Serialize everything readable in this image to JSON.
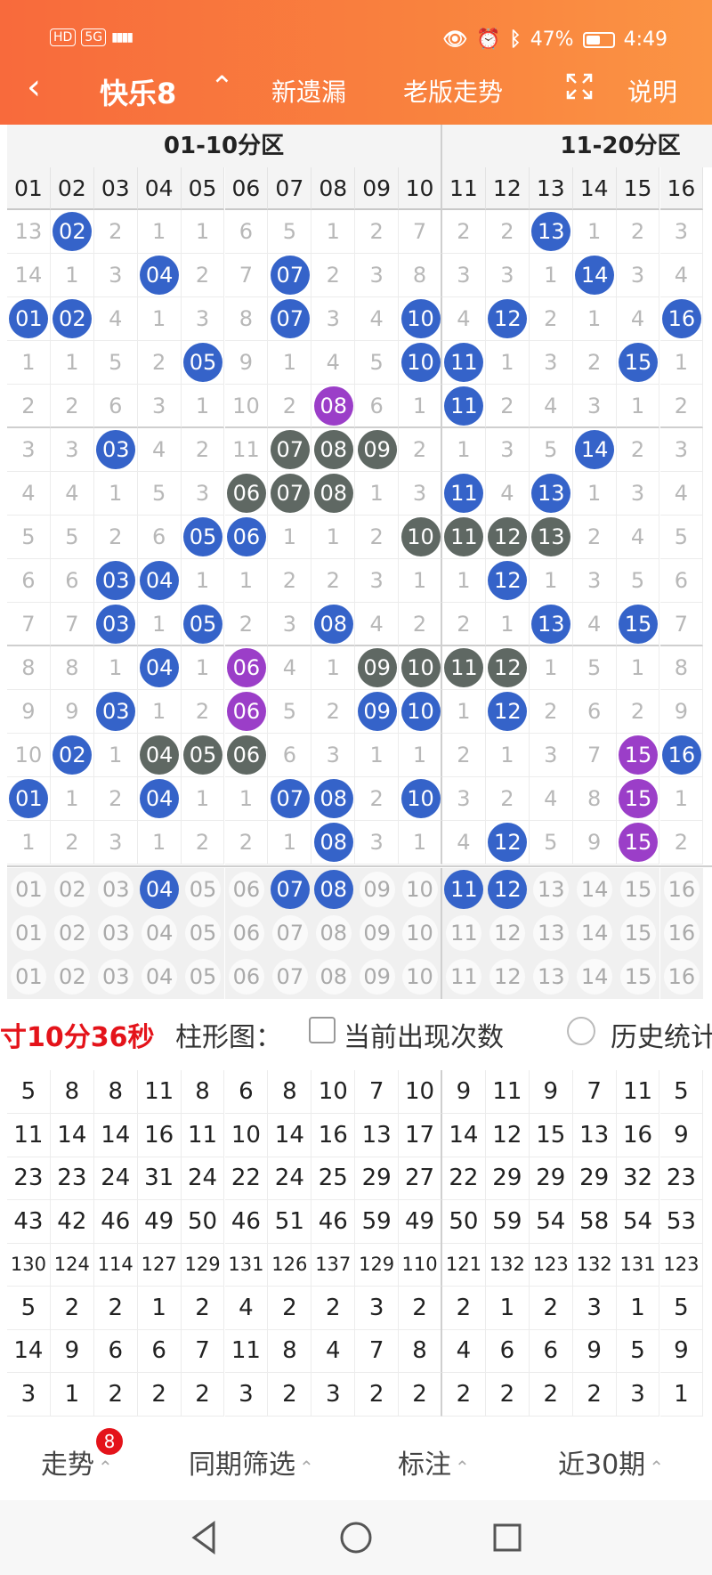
{
  "status_bar": {
    "badges": [
      "HD",
      "5G"
    ],
    "signal": "▮▮▮▮",
    "battery": "47%",
    "time": "4:49"
  },
  "nav": {
    "title": "快乐8",
    "items": [
      "新遗漏",
      "老版走势",
      "说明"
    ]
  },
  "zones": [
    "01-10分区",
    "11-20分区"
  ],
  "columns": [
    "01",
    "02",
    "03",
    "04",
    "05",
    "06",
    "07",
    "08",
    "09",
    "10",
    "11",
    "12",
    "13",
    "14",
    "15",
    "16"
  ],
  "grid_rows": [
    [
      "13",
      "02",
      "2",
      "1",
      "1",
      "6",
      "5",
      "1",
      "2",
      "7",
      "2",
      "2",
      "13",
      "1",
      "2",
      "3"
    ],
    [
      "14",
      "1",
      "3",
      "04",
      "2",
      "7",
      "07",
      "2",
      "3",
      "8",
      "3",
      "3",
      "1",
      "14",
      "3",
      "4"
    ],
    [
      "01",
      "02",
      "4",
      "1",
      "3",
      "8",
      "07",
      "3",
      "4",
      "10",
      "4",
      "12",
      "2",
      "1",
      "4",
      "16"
    ],
    [
      "1",
      "1",
      "5",
      "2",
      "05",
      "9",
      "1",
      "4",
      "5",
      "10",
      "11",
      "1",
      "3",
      "2",
      "15",
      "1"
    ],
    [
      "2",
      "2",
      "6",
      "3",
      "1",
      "10",
      "2",
      "08",
      "6",
      "1",
      "11",
      "2",
      "4",
      "3",
      "1",
      "2"
    ],
    [
      "3",
      "3",
      "03",
      "4",
      "2",
      "11",
      "07",
      "08",
      "09",
      "2",
      "1",
      "3",
      "5",
      "14",
      "2",
      "3"
    ],
    [
      "4",
      "4",
      "1",
      "5",
      "3",
      "06",
      "07",
      "08",
      "1",
      "3",
      "11",
      "4",
      "13",
      "1",
      "3",
      "4"
    ],
    [
      "5",
      "5",
      "2",
      "6",
      "05",
      "06",
      "1",
      "1",
      "2",
      "10",
      "11",
      "12",
      "13",
      "2",
      "4",
      "5"
    ],
    [
      "6",
      "6",
      "03",
      "04",
      "1",
      "1",
      "2",
      "2",
      "3",
      "1",
      "1",
      "12",
      "1",
      "3",
      "5",
      "6"
    ],
    [
      "7",
      "7",
      "03",
      "1",
      "05",
      "2",
      "3",
      "08",
      "4",
      "2",
      "2",
      "1",
      "13",
      "4",
      "15",
      "7"
    ],
    [
      "8",
      "8",
      "1",
      "04",
      "1",
      "06",
      "4",
      "1",
      "09",
      "10",
      "11",
      "12",
      "1",
      "5",
      "1",
      "8"
    ],
    [
      "9",
      "9",
      "03",
      "1",
      "2",
      "06",
      "5",
      "2",
      "09",
      "10",
      "1",
      "12",
      "2",
      "6",
      "2",
      "9"
    ],
    [
      "10",
      "02",
      "1",
      "04",
      "05",
      "06",
      "6",
      "3",
      "1",
      "1",
      "2",
      "1",
      "3",
      "7",
      "15",
      "16"
    ],
    [
      "01",
      "1",
      "2",
      "04",
      "1",
      "1",
      "07",
      "08",
      "2",
      "10",
      "3",
      "2",
      "4",
      "8",
      "15",
      "1"
    ],
    [
      "1",
      "2",
      "3",
      "1",
      "2",
      "2",
      "1",
      "08",
      "3",
      "1",
      "4",
      "12",
      "5",
      "9",
      "15",
      "2"
    ]
  ],
  "ball_styles": [
    [
      "",
      "b",
      "",
      "",
      "",
      "",
      "",
      "",
      "",
      "",
      "",
      "",
      "b",
      "",
      "",
      ""
    ],
    [
      "",
      "",
      "",
      "b",
      "",
      "",
      "b",
      "",
      "",
      "",
      "",
      "",
      "",
      "b",
      "",
      ""
    ],
    [
      "b",
      "b",
      "",
      "",
      "",
      "",
      "b",
      "",
      "",
      "b",
      "",
      "b",
      "",
      "",
      "",
      "b"
    ],
    [
      "",
      "",
      "",
      "",
      "b",
      "",
      "",
      "",
      "",
      "b",
      "b",
      "",
      "",
      "",
      "b",
      ""
    ],
    [
      "",
      "",
      "",
      "",
      "",
      "",
      "",
      "p",
      "",
      "",
      "b",
      "",
      "",
      "",
      "",
      ""
    ],
    [
      "",
      "",
      "b",
      "",
      "",
      "",
      "g",
      "g",
      "g",
      "",
      "",
      "",
      "",
      "b",
      "",
      ""
    ],
    [
      "",
      "",
      "",
      "",
      "",
      "g",
      "g",
      "g",
      "",
      "",
      "b",
      "",
      "b",
      "",
      "",
      ""
    ],
    [
      "",
      "",
      "",
      "",
      "b",
      "b",
      "",
      "",
      "",
      "g",
      "g",
      "g",
      "g",
      "",
      "",
      ""
    ],
    [
      "",
      "",
      "b",
      "b",
      "",
      "",
      "",
      "",
      "",
      "",
      "",
      "b",
      "",
      "",
      "",
      ""
    ],
    [
      "",
      "",
      "b",
      "",
      "b",
      "",
      "",
      "b",
      "",
      "",
      "",
      "",
      "b",
      "",
      "b",
      ""
    ],
    [
      "",
      "",
      "",
      "b",
      "",
      "p",
      "",
      "",
      "g",
      "g",
      "g",
      "g",
      "",
      "",
      "",
      ""
    ],
    [
      "",
      "",
      "b",
      "",
      "",
      "p",
      "",
      "",
      "b",
      "b",
      "",
      "b",
      "",
      "",
      "",
      ""
    ],
    [
      "",
      "b",
      "",
      "g",
      "g",
      "g",
      "",
      "",
      "",
      "",
      "",
      "",
      "",
      "",
      "p",
      "b"
    ],
    [
      "b",
      "",
      "",
      "b",
      "",
      "",
      "b",
      "b",
      "",
      "b",
      "",
      "",
      "",
      "",
      "p",
      ""
    ],
    [
      "",
      "",
      "",
      "",
      "",
      "",
      "",
      "b",
      "",
      "",
      "",
      "b",
      "",
      "",
      "p",
      ""
    ]
  ],
  "selection_rows": [
    {
      "values": [
        "01",
        "02",
        "03",
        "04",
        "05",
        "06",
        "07",
        "08",
        "09",
        "10",
        "11",
        "12",
        "13",
        "14",
        "15",
        "16"
      ],
      "selected": [
        "04",
        "07",
        "08",
        "11",
        "12"
      ]
    },
    {
      "values": [
        "01",
        "02",
        "03",
        "04",
        "05",
        "06",
        "07",
        "08",
        "09",
        "10",
        "11",
        "12",
        "13",
        "14",
        "15",
        "16"
      ],
      "selected": []
    },
    {
      "values": [
        "01",
        "02",
        "03",
        "04",
        "05",
        "06",
        "07",
        "08",
        "09",
        "10",
        "11",
        "12",
        "13",
        "14",
        "15",
        "16"
      ],
      "selected": []
    }
  ],
  "countdown": "寸10分36秒",
  "chart_options": {
    "label": "柱形图：",
    "option1": "当前出现次数",
    "option2": "历史统计"
  },
  "stats_rows": [
    [
      "5",
      "8",
      "8",
      "11",
      "8",
      "6",
      "8",
      "10",
      "7",
      "10",
      "9",
      "11",
      "9",
      "7",
      "11",
      "5"
    ],
    [
      "11",
      "14",
      "14",
      "16",
      "11",
      "10",
      "14",
      "16",
      "13",
      "17",
      "14",
      "12",
      "15",
      "13",
      "16",
      "9"
    ],
    [
      "23",
      "23",
      "24",
      "31",
      "24",
      "22",
      "24",
      "25",
      "29",
      "27",
      "22",
      "29",
      "29",
      "29",
      "32",
      "23"
    ],
    [
      "43",
      "42",
      "46",
      "49",
      "50",
      "46",
      "51",
      "46",
      "59",
      "49",
      "50",
      "59",
      "54",
      "58",
      "54",
      "53"
    ],
    [
      "130",
      "124",
      "114",
      "127",
      "129",
      "131",
      "126",
      "137",
      "129",
      "110",
      "121",
      "132",
      "123",
      "132",
      "131",
      "123"
    ],
    [
      "5",
      "2",
      "2",
      "1",
      "2",
      "4",
      "2",
      "2",
      "3",
      "2",
      "2",
      "1",
      "2",
      "3",
      "1",
      "5"
    ],
    [
      "14",
      "9",
      "6",
      "6",
      "7",
      "11",
      "8",
      "4",
      "7",
      "8",
      "4",
      "6",
      "6",
      "9",
      "5",
      "9"
    ],
    [
      "3",
      "1",
      "2",
      "2",
      "2",
      "3",
      "2",
      "3",
      "2",
      "2",
      "2",
      "2",
      "2",
      "2",
      "3",
      "1"
    ]
  ],
  "bottom_tabs": [
    {
      "label": "走势",
      "badge": "8"
    },
    {
      "label": "同期筛选"
    },
    {
      "label": "标注"
    },
    {
      "label": "近30期"
    }
  ],
  "colors": {
    "header": "#f86a3c",
    "ball_blue": "#3563c9",
    "ball_gray": "#5f6863",
    "ball_purple": "#9b3ec8",
    "countdown": "#e4131a"
  }
}
